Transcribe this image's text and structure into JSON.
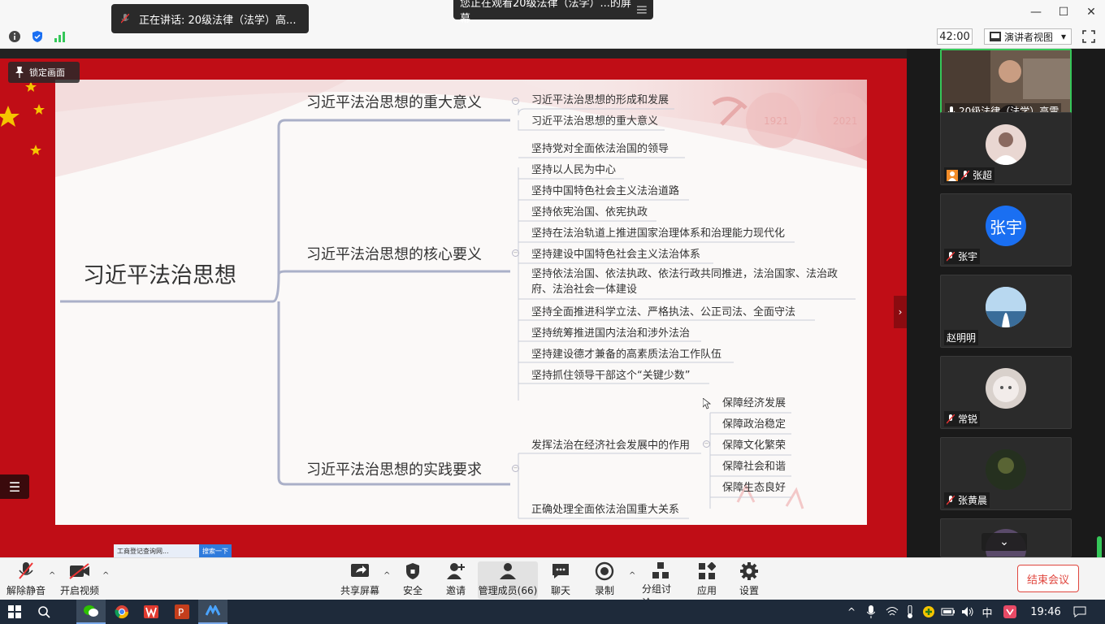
{
  "window": {
    "speaking": "正在讲话: 20级法律（法学）高...",
    "viewing": "您正在观看20级法律（法学）...的屏幕",
    "minimize": "—",
    "maximize": "☐",
    "close": "✕"
  },
  "topbar": {
    "timer": "42:00",
    "view_mode": "演讲者视图",
    "view_mode_arrow": "▾"
  },
  "share": {
    "lock_label": "锁定画面",
    "browser_chip": "工商登记查询网...",
    "browser_chip_btn": "搜索一下",
    "expand_arrow": "›",
    "list_icon_glyph": "☰"
  },
  "mindmap": {
    "root": "习近平法治思想",
    "deco_years": [
      "1921",
      "2021"
    ],
    "branches": [
      {
        "title": "习近平法治思想的重大意义",
        "items": [
          "习近平法治思想的形成和发展",
          "习近平法治思想的重大意义"
        ]
      },
      {
        "title": "习近平法治思想的核心要义",
        "items": [
          "坚持党对全面依法治国的领导",
          "坚持以人民为中心",
          "坚持中国特色社会主义法治道路",
          "坚持依宪治国、依宪执政",
          "坚持在法治轨道上推进国家治理体系和治理能力现代化",
          "坚持建设中国特色社会主义法治体系",
          "坚持依法治国、依法执政、依法行政共同推进，法治国家、法治政府、法治社会一体建设",
          "坚持全面推进科学立法、严格执法、公正司法、全面守法",
          "坚持统筹推进国内法治和涉外法治",
          "坚持建设德才兼备的高素质法治工作队伍",
          "坚持抓住领导干部这个“关键少数”"
        ]
      },
      {
        "title": "习近平法治思想的实践要求",
        "items": [
          "发挥法治在经济社会发展中的作用",
          "正确处理全面依法治国重大关系"
        ],
        "subitems": [
          "保障经济发展",
          "保障政治稳定",
          "保障文化繁荣",
          "保障社会和谐",
          "保障生态良好"
        ]
      }
    ]
  },
  "participants": [
    {
      "name": "20级法律（法学）高雷",
      "type": "video"
    },
    {
      "name": "张超",
      "type": "photo"
    },
    {
      "name": "张宇",
      "type": "text",
      "avatar_text": "张宇"
    },
    {
      "name": "赵明明",
      "type": "photo"
    },
    {
      "name": "常锐",
      "type": "photo"
    },
    {
      "name": "张黄晨",
      "type": "photo"
    },
    {
      "name": "",
      "type": "photo"
    }
  ],
  "panel": {
    "down_arrow": "⌄"
  },
  "bottombar": {
    "unmute": "解除静音",
    "start_video": "开启视频",
    "share_screen": "共享屏幕",
    "security": "安全",
    "invite": "邀请",
    "manage": "管理成员(66)",
    "chat": "聊天",
    "record": "录制",
    "breakout": "分组讨论",
    "apps": "应用",
    "settings": "设置",
    "end": "结束会议",
    "caret": "^"
  },
  "taskbar": {
    "time": "19:46",
    "ime": "中",
    "chevron": "^"
  },
  "colors": {
    "slide_bg": "#c00d16",
    "accent_green": "#35c759",
    "end_red": "#e0463e",
    "zoom_blue": "#1a6ff2"
  }
}
